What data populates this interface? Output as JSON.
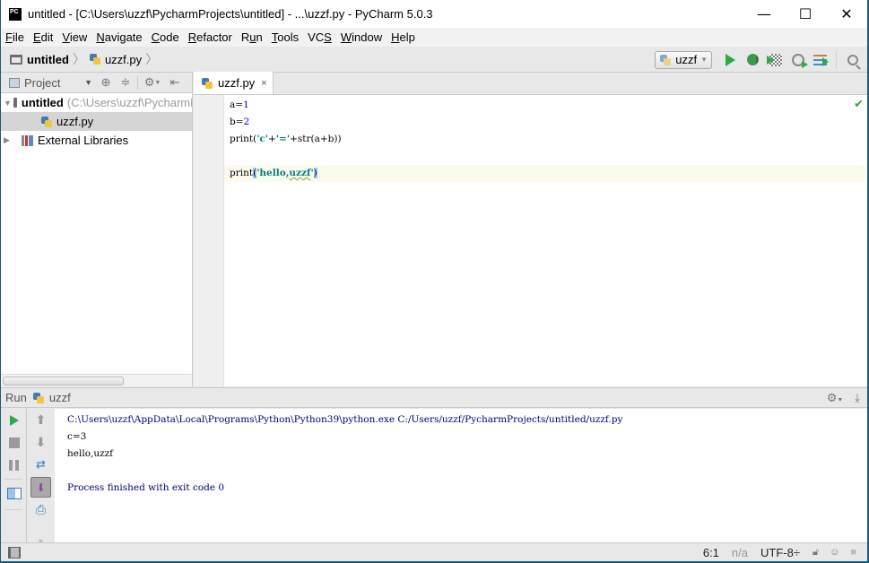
{
  "window": {
    "logo": "PC",
    "title": "untitled - [C:\\Users\\uzzf\\PycharmProjects\\untitled] - ...\\uzzf.py - PyCharm 5.0.3",
    "minimize": "—",
    "maximize": "☐",
    "close": "✕"
  },
  "menu": [
    {
      "u": "F",
      "rest": "ile"
    },
    {
      "u": "E",
      "rest": "dit"
    },
    {
      "u": "V",
      "rest": "iew"
    },
    {
      "u": "N",
      "rest": "avigate"
    },
    {
      "u": "C",
      "rest": "ode"
    },
    {
      "u": "R",
      "rest": "efactor"
    },
    {
      "pre": "R",
      "u": "u",
      "rest": "n"
    },
    {
      "u": "T",
      "rest": "ools"
    },
    {
      "pre": "VC",
      "u": "S",
      "rest": ""
    },
    {
      "u": "W",
      "rest": "indow"
    },
    {
      "u": "H",
      "rest": "elp"
    }
  ],
  "breadcrumb": {
    "project": "untitled",
    "file": "uzzf.py",
    "sep": "〉"
  },
  "toolbar": {
    "run_config": "uzzf",
    "icons": [
      "run-icon",
      "debug-icon",
      "coverage-icon",
      "profile-icon",
      "concurrency-icon",
      "search-icon"
    ]
  },
  "project_panel": {
    "tab_label": "Project",
    "tree": [
      {
        "name": "untitled",
        "path": "(C:\\Users\\uzzf\\PycharmProjects\\untitled)",
        "expanded": true
      },
      {
        "name": "uzzf.py",
        "selected": true
      },
      {
        "name": "External Libraries",
        "expanded": false
      }
    ]
  },
  "editor": {
    "tab": "uzzf.py",
    "tab_close": "×",
    "status_check": "✔",
    "lines": [
      {
        "a": "a=",
        "n": "1"
      },
      {
        "a": "b=",
        "n": "2"
      },
      {
        "p1": "print(",
        "s1": "'c'",
        "p2": "+",
        "s2": "'='",
        "p3": "+str(a+b))"
      },
      {},
      {
        "p1": "print",
        "b1": "(",
        "s1": "'hello,",
        "typo": "uzzf",
        "s2": "'",
        "b2": ")"
      }
    ]
  },
  "run_panel": {
    "label": "Run",
    "config": "uzzf",
    "output": [
      "C:\\Users\\uzzf\\AppData\\Local\\Programs\\Python\\Python39\\python.exe C:/Users/uzzf/PycharmProjects/untitled/uzzf.py",
      "c=3",
      "hello,uzzf",
      "",
      "Process finished with exit code 0"
    ],
    "more": "»"
  },
  "statusbar": {
    "position": "6:1",
    "line_sep": "n/a",
    "encoding": "UTF-8÷"
  },
  "colors": {
    "accent_green": "#2fa847",
    "number": "#0000ff",
    "string": "#008080",
    "console_system": "#000080"
  }
}
